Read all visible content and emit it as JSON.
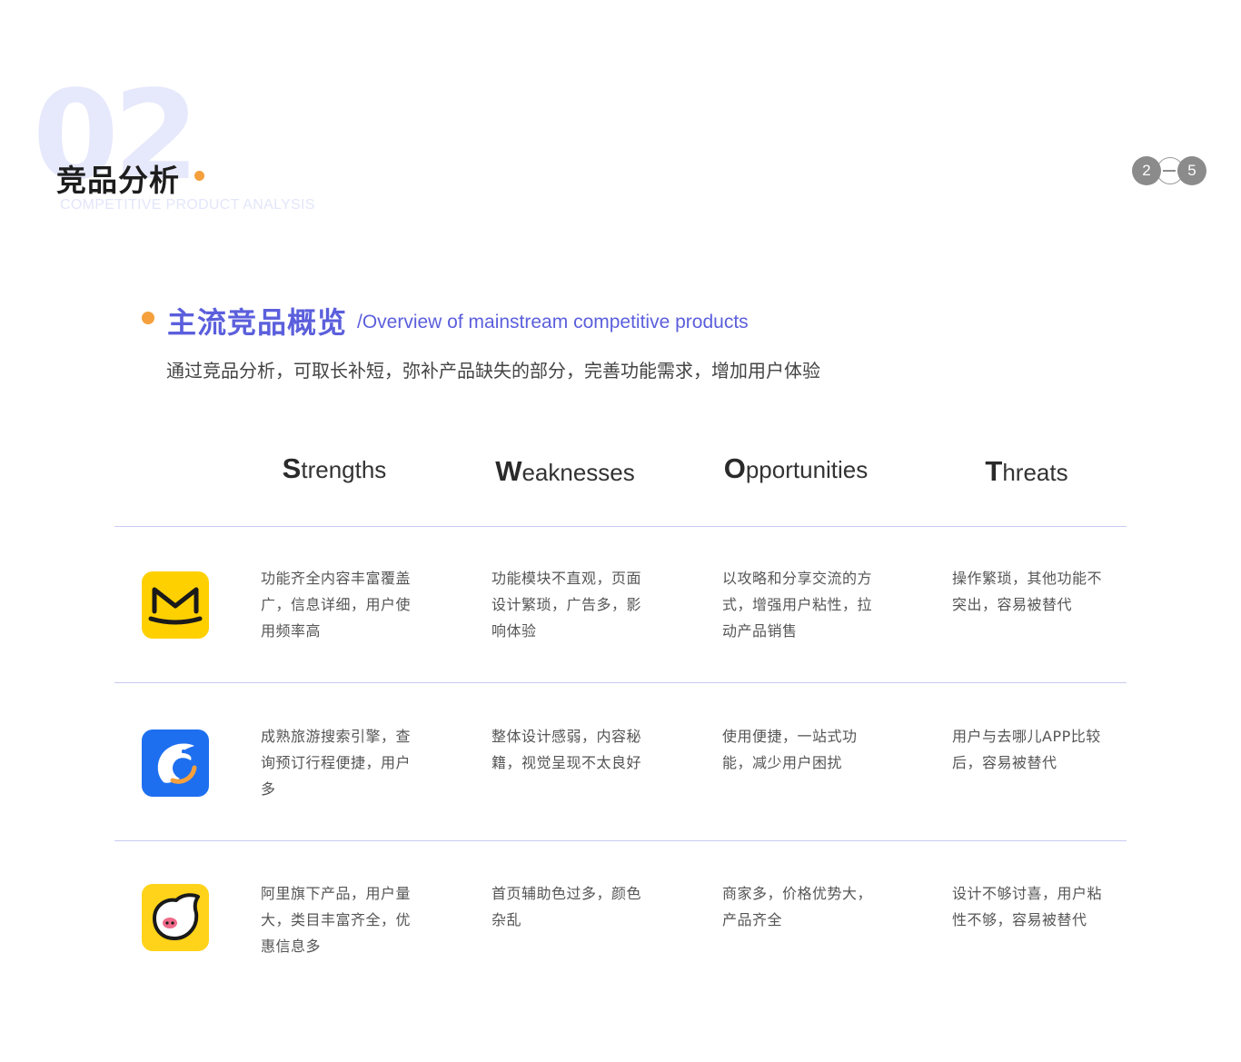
{
  "section": {
    "number": "02",
    "title": "竞品分析",
    "subtitle": "COMPETITIVE PRODUCT ANALYSIS"
  },
  "pager": {
    "current": "2",
    "total": "5"
  },
  "overview": {
    "title": "主流竞品概览",
    "english": "/Overview of mainstream competitive products",
    "intro": "通过竞品分析，可取长补短，弥补产品缺失的部分，完善功能需求，增加用户体验"
  },
  "swot": {
    "headers": [
      {
        "cap": "S",
        "rest": "trengths"
      },
      {
        "cap": "W",
        "rest": "eaknesses"
      },
      {
        "cap": "O",
        "rest": "pportunities"
      },
      {
        "cap": "T",
        "rest": "hreats"
      }
    ],
    "rows": [
      {
        "icon": "meituan-yellow-m-icon",
        "icon_color": "#ffd000",
        "cells": [
          "功能齐全内容丰富覆盖广，信息详细，用户使用频率高",
          "功能模块不直观，页面设计繁琐，广告多，影响体验",
          "以攻略和分享交流的方式，增强用户粘性，拉动产品销售",
          "操作繁琐，其他功能不突出，容易被替代"
        ]
      },
      {
        "icon": "ctrip-dolphin-icon",
        "icon_color": "#1e6ff0",
        "cells": [
          "成熟旅游搜索引擎，查询预订行程便捷，用户多",
          "整体设计感弱，内容秘籍，视觉呈现不太良好",
          "使用便捷，一站式功能，减少用户困扰",
          "用户与去哪儿APP比较后，容易被替代"
        ]
      },
      {
        "icon": "fliggy-pig-icon",
        "icon_color": "#ffd31a",
        "cells": [
          "阿里旗下产品，用户量大，类目丰富齐全，优惠信息多",
          "首页辅助色过多，颜色杂乱",
          "商家多，价格优势大，产品齐全",
          "设计不够讨喜，用户粘性不够，容易被替代"
        ]
      }
    ]
  },
  "colors": {
    "accent": "#5b5fdc",
    "orange": "#f5a03c",
    "divider": "#c9caf2"
  }
}
